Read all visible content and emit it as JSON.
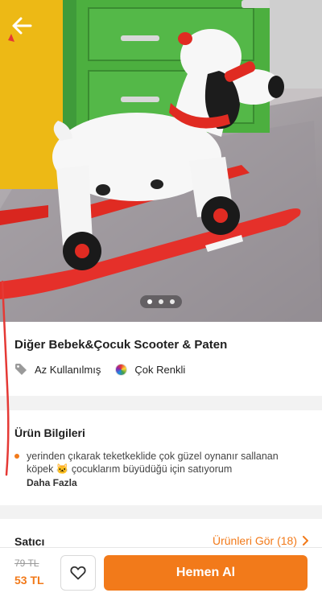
{
  "product": {
    "title": "Diğer Bebek&Çocuk Scooter & Paten",
    "condition": "Az Kullanılmış",
    "color": "Çok Renkli",
    "gallery": {
      "total_images": 3,
      "active_index": 0
    }
  },
  "info": {
    "section_title": "Ürün Bilgileri",
    "description": "yerinden çıkarak teketkeklide çok güzel oynanır sallanan köpek 🐱 çocuklarım büyüdüğü için satıyorum",
    "more_label": "Daha Fazla"
  },
  "seller": {
    "label": "Satıcı",
    "products_link": "Ürünleri Gör (18)"
  },
  "price": {
    "old": "79 TL",
    "current": "53 TL"
  },
  "actions": {
    "buy_label": "Hemen Al"
  },
  "colors": {
    "accent": "#f27a1a",
    "toy_red": "#e53935"
  },
  "icons": {
    "back": "arrow-left-icon",
    "condition": "tag-icon",
    "color": "color-wheel-icon",
    "favorite": "heart-icon",
    "chevron": "chevron-right-icon"
  }
}
